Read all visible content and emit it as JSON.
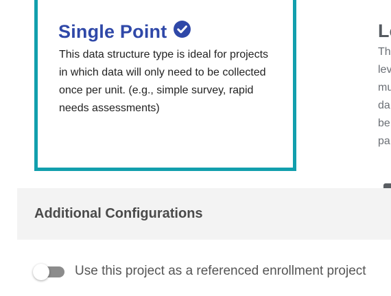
{
  "cards": {
    "single_point": {
      "title": "Single Point",
      "selected": true,
      "description": "This data structure type is ideal for projects in which data will only need to be collected once per unit. (e.g., simple survey, rapid needs assessments)"
    },
    "second": {
      "title_visible": "Lo",
      "description_lines_visible": [
        "Th",
        "lev",
        "mu",
        "da",
        "be",
        "pa"
      ]
    }
  },
  "additional_configurations": {
    "heading": "Additional Configurations"
  },
  "referenced_enrollment": {
    "label": "Use this project as a referenced enrollment project",
    "enabled": false
  },
  "colors": {
    "selected_border": "#129fad",
    "title_blue": "#2f48a8",
    "panel_bg": "#f3f3f3",
    "toggle_off": "#8c8c8c"
  },
  "icons": {
    "selected_check": "check-circle-icon"
  }
}
